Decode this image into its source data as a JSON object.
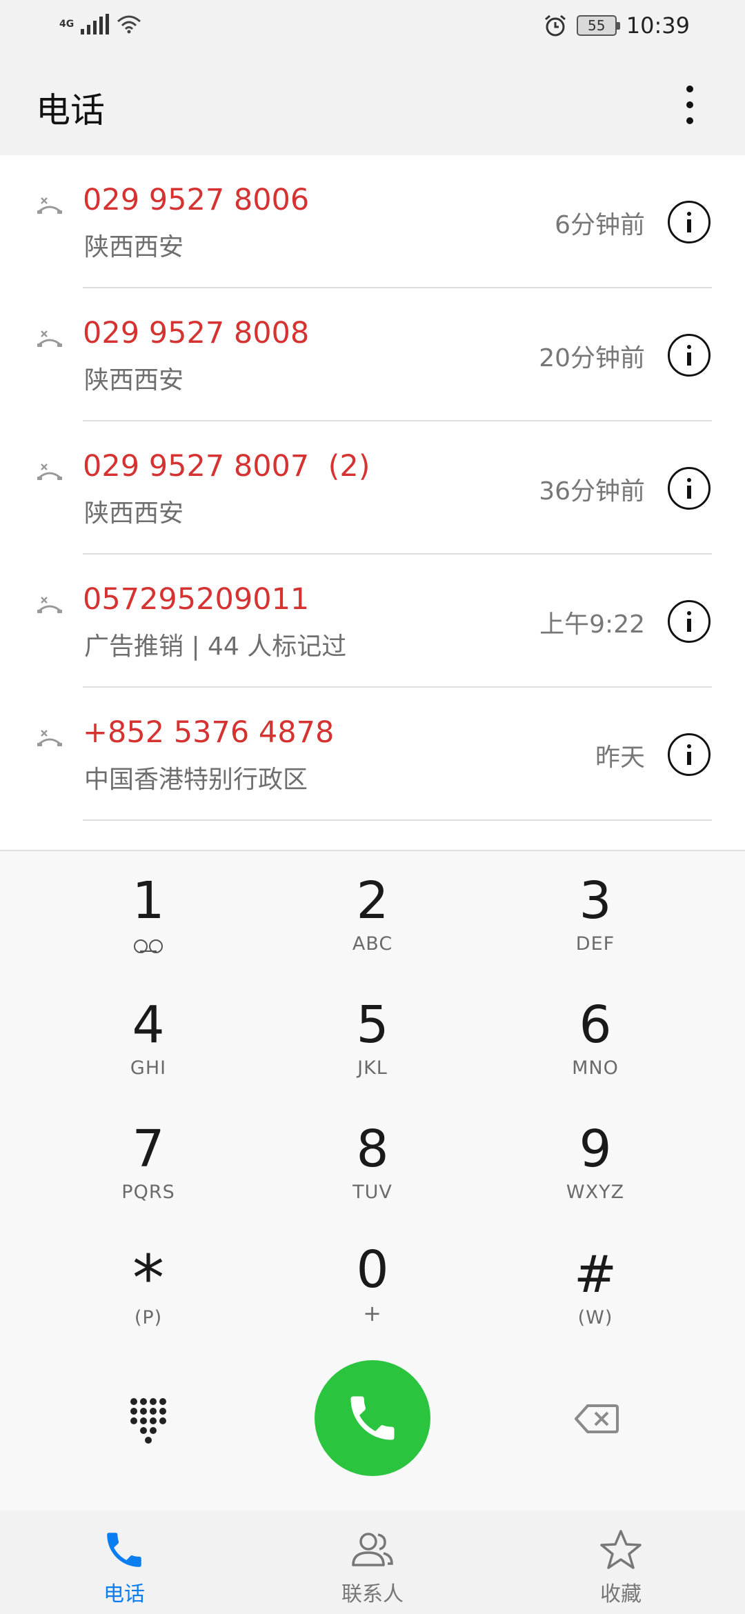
{
  "status_bar": {
    "network": "4G",
    "battery": "55",
    "time": "10:39"
  },
  "header": {
    "title": "电话"
  },
  "call_log": [
    {
      "number": "029 9527 8006",
      "location": "陕西西安",
      "time": "6分钟前"
    },
    {
      "number": "029 9527 8008",
      "location": "陕西西安",
      "time": "20分钟前"
    },
    {
      "number": "029 9527 8007  (2)",
      "location": "陕西西安",
      "time": "36分钟前"
    },
    {
      "number": "057295209011",
      "location": "广告推销 | 44 人标记过",
      "time": "上午9:22"
    },
    {
      "number": "+852 5376 4878",
      "location": "中国香港特别行政区",
      "time": "昨天"
    }
  ],
  "dialpad": {
    "keys": [
      {
        "digit": "1",
        "letters": ""
      },
      {
        "digit": "2",
        "letters": "ABC"
      },
      {
        "digit": "3",
        "letters": "DEF"
      },
      {
        "digit": "4",
        "letters": "GHI"
      },
      {
        "digit": "5",
        "letters": "JKL"
      },
      {
        "digit": "6",
        "letters": "MNO"
      },
      {
        "digit": "7",
        "letters": "PQRS"
      },
      {
        "digit": "8",
        "letters": "TUV"
      },
      {
        "digit": "9",
        "letters": "WXYZ"
      },
      {
        "digit": "*",
        "letters": "(P)"
      },
      {
        "digit": "0",
        "letters": "+"
      },
      {
        "digit": "#",
        "letters": "(W)"
      }
    ],
    "call_color": "#2ac43e"
  },
  "bottom_nav": {
    "items": [
      {
        "label": "电话",
        "icon": "phone-icon",
        "active": true
      },
      {
        "label": "联系人",
        "icon": "contacts-icon",
        "active": false
      },
      {
        "label": "收藏",
        "icon": "star-icon",
        "active": false
      }
    ],
    "active_color": "#0a7ef0"
  },
  "colors": {
    "missed_call": "#d43331",
    "accent": "#0a7ef0"
  }
}
